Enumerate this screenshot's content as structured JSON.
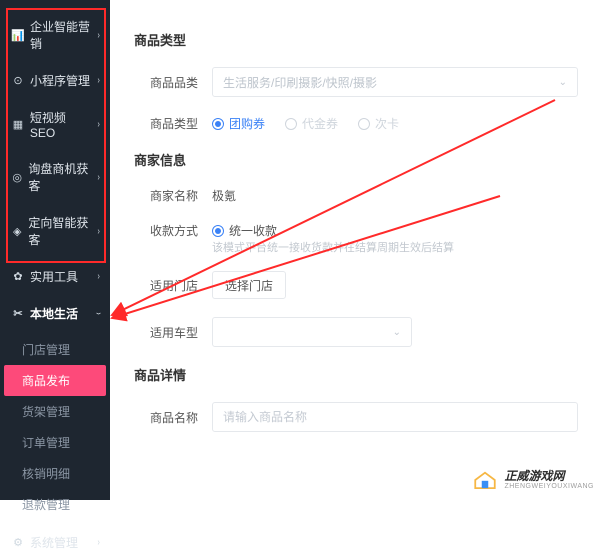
{
  "sidebar": {
    "top": [
      {
        "icon": "📊",
        "label": "企业智能营销"
      },
      {
        "icon": "⊙",
        "label": "小程序管理"
      },
      {
        "icon": "▦",
        "label": "短视频SEO"
      },
      {
        "icon": "◎",
        "label": "询盘商机获客"
      },
      {
        "icon": "◈",
        "label": "定向智能获客"
      },
      {
        "icon": "✿",
        "label": "实用工具"
      }
    ],
    "local_life": {
      "icon": "✂",
      "label": "本地生活"
    },
    "subs": [
      {
        "label": "门店管理"
      },
      {
        "label": "商品发布"
      },
      {
        "label": "货架管理"
      },
      {
        "label": "订单管理"
      },
      {
        "label": "核销明细"
      },
      {
        "label": "退款管理"
      }
    ],
    "bottom": {
      "icon": "⚙",
      "label": "系统管理"
    }
  },
  "form": {
    "type_section": "商品类型",
    "cat_label": "商品品类",
    "cat_placeholder": "生活服务/印刷摄影/快照/摄影",
    "type_label": "商品类型",
    "type_options": [
      "团购券",
      "代金券",
      "次卡"
    ],
    "merchant_section": "商家信息",
    "merchant_name_label": "商家名称",
    "merchant_name_value": "极氪",
    "pay_label": "收款方式",
    "pay_option": "统一收款",
    "pay_helper": "该模式平台统一接收货款并在结算周期生效后结算",
    "stores_label": "适用门店",
    "stores_btn": "选择门店",
    "cartype_label": "适用车型",
    "detail_section": "商品详情",
    "name_label": "商品名称",
    "name_placeholder": "请输入商品名称"
  },
  "watermark": {
    "cn": "正威游戏网",
    "en": "ZHENGWEIYOUXIWANG"
  }
}
